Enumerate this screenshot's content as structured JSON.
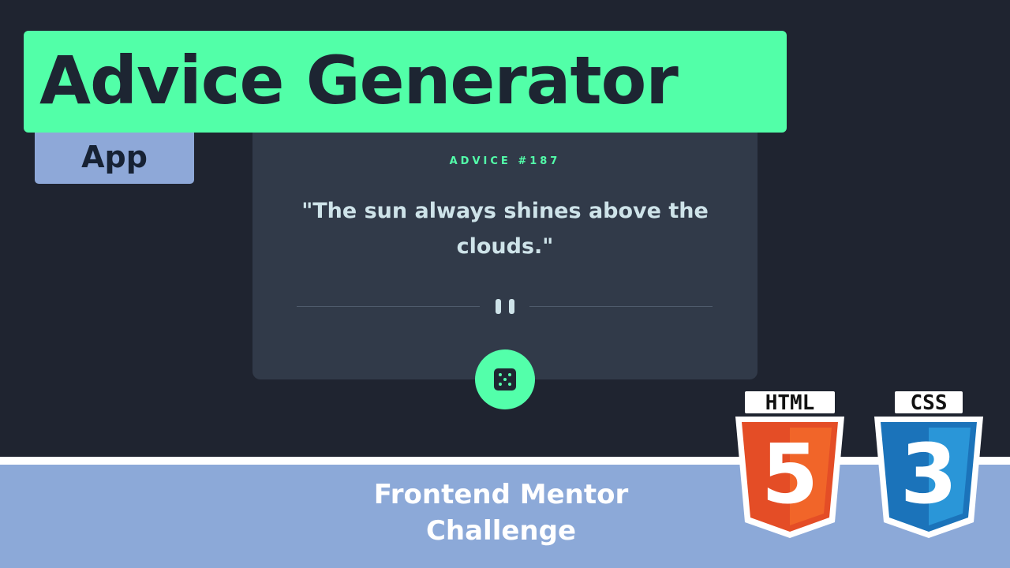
{
  "title": {
    "main": "Advice Generator",
    "tag": "App"
  },
  "card": {
    "advice_label": "ADVICE #187",
    "quote": "\"The sun always shines above the clouds.\""
  },
  "footer": {
    "line1": "Frontend Mentor",
    "line2": "Challenge"
  },
  "badges": {
    "html": "HTML",
    "css": "CSS",
    "html_number": "5",
    "css_number": "3"
  },
  "icons": {
    "pause": "pause-icon",
    "dice": "dice-icon"
  },
  "colors": {
    "background": "#1f2430",
    "card": "#313a49",
    "accent": "#53ffaa",
    "quote_text": "#cee3e9",
    "title_banner": "#52ffa8",
    "title_text": "#1d2532",
    "tag": "#8ea8d8",
    "footer_band": "#8ca9d8",
    "html_orange": "#e44d26",
    "css_blue": "#1b73ba"
  }
}
